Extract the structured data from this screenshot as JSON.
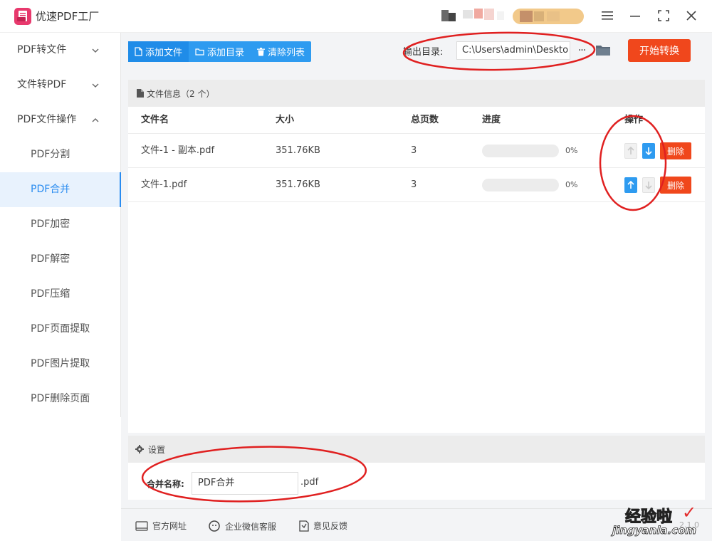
{
  "app": {
    "title": "优速PDF工厂"
  },
  "sidebar": {
    "groups": [
      {
        "label": "PDF转文件",
        "chevron": "chevron-down-icon"
      },
      {
        "label": "文件转PDF",
        "chevron": "chevron-down-icon"
      },
      {
        "label": "PDF文件操作",
        "chevron": "chevron-up-icon"
      }
    ],
    "items": [
      {
        "label": "PDF分割"
      },
      {
        "label": "PDF合并",
        "active": true
      },
      {
        "label": "PDF加密"
      },
      {
        "label": "PDF解密"
      },
      {
        "label": "PDF压缩"
      },
      {
        "label": "PDF页面提取"
      },
      {
        "label": "PDF图片提取"
      },
      {
        "label": "PDF删除页面"
      }
    ]
  },
  "toolbar": {
    "add_file": "添加文件",
    "add_dir": "添加目录",
    "clear_list": "清除列表"
  },
  "output": {
    "label": "输出目录:",
    "path": "C:\\Users\\admin\\Deskto",
    "more": "···"
  },
  "start_button": "开始转换",
  "file_info": {
    "title": "文件信息（2 个）",
    "columns": [
      "文件名",
      "大小",
      "总页数",
      "进度",
      "操作"
    ],
    "rows": [
      {
        "name": "文件-1 - 副本.pdf",
        "size": "351.76KB",
        "pages": "3",
        "progress": 0,
        "progress_label": "0%",
        "up_enabled": false,
        "down_enabled": true,
        "delete": "删除"
      },
      {
        "name": "文件-1.pdf",
        "size": "351.76KB",
        "pages": "3",
        "progress": 0,
        "progress_label": "0%",
        "up_enabled": true,
        "down_enabled": false,
        "delete": "删除"
      }
    ]
  },
  "settings": {
    "title": "设置",
    "merge_label": "合并名称:",
    "merge_value": "PDF合并",
    "merge_suffix": ".pdf"
  },
  "footer": {
    "website": "官方网址",
    "wechat": "企业微信客服",
    "feedback": "意见反馈",
    "version": "2.1.0"
  },
  "watermark": {
    "cn": "经验啦",
    "url": "jingyanla.com"
  },
  "colors": {
    "primary": "#2e9bf0",
    "danger": "#f0471c",
    "annotation": "#e02020",
    "logo": "#e8396d"
  }
}
